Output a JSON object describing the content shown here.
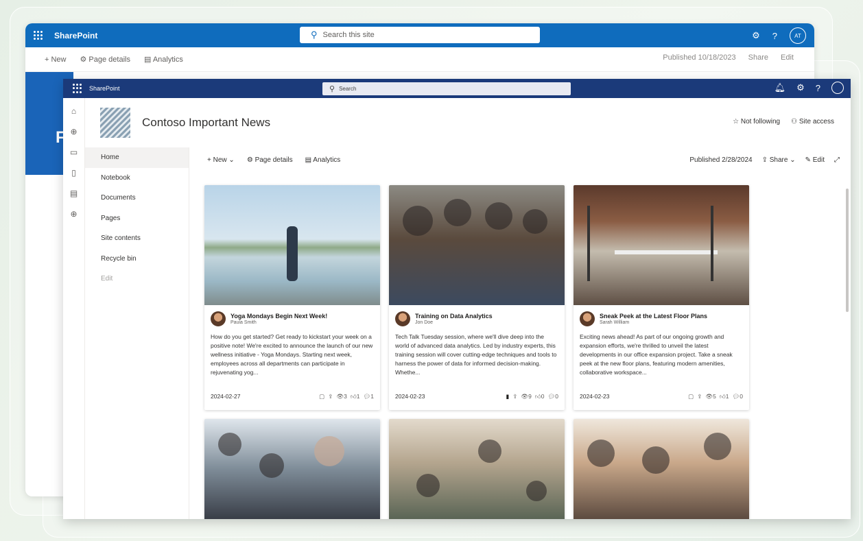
{
  "back_window": {
    "brand": "SharePoint",
    "search_placeholder": "Search this site",
    "avatar": "AT",
    "cmd": {
      "new": "+ New",
      "page_details": "Page details",
      "analytics": "Analytics"
    },
    "published": "Published 10/18/2023",
    "share": "Share",
    "edit": "Edit",
    "hero_letter": "F"
  },
  "front_window": {
    "brand": "SharePoint",
    "search_placeholder": "Search",
    "site_title": "Contoso Important News",
    "not_following": "Not following",
    "site_access": "Site access",
    "nav": [
      "Home",
      "Notebook",
      "Documents",
      "Pages",
      "Site contents",
      "Recycle bin",
      "Edit"
    ],
    "cmd": {
      "new": "New",
      "page_details": "Page details",
      "analytics": "Analytics",
      "published": "Published 2/28/2024",
      "share": "Share",
      "edit": "Edit"
    },
    "cards": [
      {
        "title": "Yoga Mondays Begin Next Week!",
        "author": "Paula Smith",
        "desc": "How do you get started? Get ready to kickstart your week on a positive note! We're excited to announce the launch of our new wellness initiative - Yoga Mondays. Starting next week, employees across all departments can participate in rejuvenating yog...",
        "date": "2024-02-27",
        "views": "3",
        "likes": "1",
        "comments": "1"
      },
      {
        "title": "Training on Data Analytics",
        "author": "Jon Doe",
        "desc": "Tech Talk Tuesday session, where we'll dive deep into the world of advanced data analytics. Led by industry experts, this training session will cover cutting-edge techniques and tools to harness the power of data for informed decision-making. Whethe...",
        "date": "2024-02-23",
        "views": "9",
        "likes": "0",
        "comments": "0"
      },
      {
        "title": "Sneak Peek at the Latest Floor Plans",
        "author": "Sarah William",
        "desc": "Exciting news ahead! As part of our ongoing growth and expansion efforts, we're thrilled to unveil the latest developments in our office expansion project. Take a sneak peek at the new floor plans, featuring modern amenities, collaborative workspace...",
        "date": "2024-02-23",
        "views": "5",
        "likes": "1",
        "comments": "0"
      }
    ]
  }
}
